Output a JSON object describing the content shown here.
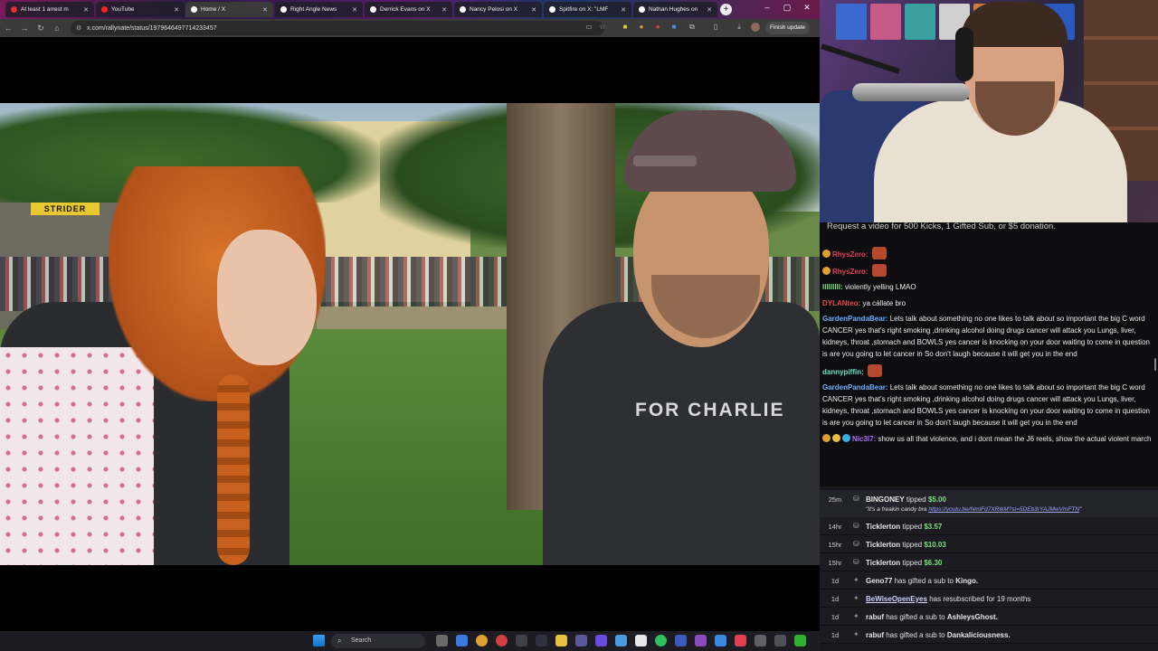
{
  "browser": {
    "tabs": [
      {
        "label": "At least 1 arrest m",
        "color": "#e03030"
      },
      {
        "label": "YouTube",
        "color": "#ff2020"
      },
      {
        "label": "Home / X",
        "color": "#ffffff"
      },
      {
        "label": "Right Angle News",
        "color": "#ffffff"
      },
      {
        "label": "Derrick Evans on X",
        "color": "#ffffff"
      },
      {
        "label": "Nancy Pelosi on X",
        "color": "#ffffff"
      },
      {
        "label": "Spitfire on X: \"LMF",
        "color": "#ffffff"
      },
      {
        "label": "Nathan Hughes on",
        "color": "#ffffff"
      }
    ],
    "new_tab": "+",
    "url": "x.com/rallynate/status/1979646497714233457",
    "finish_update": "Finish update",
    "window_controls": [
      "–",
      "▢",
      "✕"
    ]
  },
  "video": {
    "shirt_text": "FOR CHARLIE",
    "store_sign": "STRIDER"
  },
  "taskbar": {
    "search_placeholder": "Search"
  },
  "chat": {
    "banner": "Request a video for 500 Kicks, 1 Gifted Sub, or $5 donation.",
    "messages": [
      {
        "user": "RhysZero:",
        "color": "#e0405a",
        "text": "",
        "emote": true
      },
      {
        "user": "RhysZero:",
        "color": "#e0405a",
        "text": "",
        "emote": true
      },
      {
        "user": "lllllllll:",
        "color": "#7de07d",
        "text": "violently yelling LMAO",
        "emote": false
      },
      {
        "user": "DYLANteo:",
        "color": "#e84848",
        "text": "ya cállate bro",
        "emote": false
      },
      {
        "user": "GardenPandaBear:",
        "color": "#6ab0ff",
        "text": "Lets talk about something no one likes to talk about so important the big C word CANCER yes that's right smoking ,drinking alcohol doing drugs cancer will attack you Lungs, liver, kidneys, throat ,stomach and BOWLS yes cancer is knocking on your door waiting to come in question is are you going to let cancer in So don't laugh because it will get you in the end",
        "emote": false
      },
      {
        "user": "dannypiffin:",
        "color": "#6ae0c0",
        "text": "",
        "emote": true
      },
      {
        "user": "GardenPandaBear:",
        "color": "#6ab0ff",
        "text": "Lets talk about something no one likes to talk about so important the big C word CANCER yes that's right smoking ,drinking alcohol doing drugs cancer will attack you Lungs, liver, kidneys, throat ,stomach and BOWLS yes cancer is knocking on your door waiting to come in question is are you going to let cancer in So don't laugh because it will get you in the end",
        "emote": false
      },
      {
        "user": "Nic3l7:",
        "color": "#b070ff",
        "text": "show us all that violence, and i dont mean the J6 reels, show the actual violent march",
        "emote": false
      }
    ]
  },
  "events": [
    {
      "time": "25m",
      "icon": "tip-icon",
      "name": "BINGONEY",
      "action": "tipped",
      "amount": "$5.00",
      "quote": "\"It's a freakin candy bra ",
      "quote_link": "https://youtu.be/NmlFd7XRtkM?si=5DEb3rYAJMwVmFTN",
      "quote_end": "\""
    },
    {
      "time": "14hr",
      "icon": "tip-icon",
      "name": "Ticklerton",
      "action": "tipped",
      "amount": "$3.57"
    },
    {
      "time": "15hr",
      "icon": "tip-icon",
      "name": "Ticklerton",
      "action": "tipped",
      "amount": "$10.03"
    },
    {
      "time": "15hr",
      "icon": "tip-icon",
      "name": "Ticklerton",
      "action": "tipped",
      "amount": "$6.30"
    },
    {
      "time": "1d",
      "icon": "kick-icon",
      "name": "Geno77",
      "action": "has gifted a sub to",
      "target": "Kingo."
    },
    {
      "time": "1d",
      "icon": "kick-icon",
      "name": "BeWiseOpenEyes",
      "action": "has resubscribed for 19 months",
      "underline": true
    },
    {
      "time": "1d",
      "icon": "kick-icon",
      "name": "rabuf",
      "action": "has gifted a sub to",
      "target": "AshleysGhost."
    },
    {
      "time": "1d",
      "icon": "kick-icon",
      "name": "rabuf",
      "action": "has gifted a sub to",
      "target": "Dankaliciousness."
    }
  ],
  "colors": {
    "accent_green": "#7ee07e",
    "chat_bg": "#0e0e10",
    "events_bg": "#17171c"
  }
}
